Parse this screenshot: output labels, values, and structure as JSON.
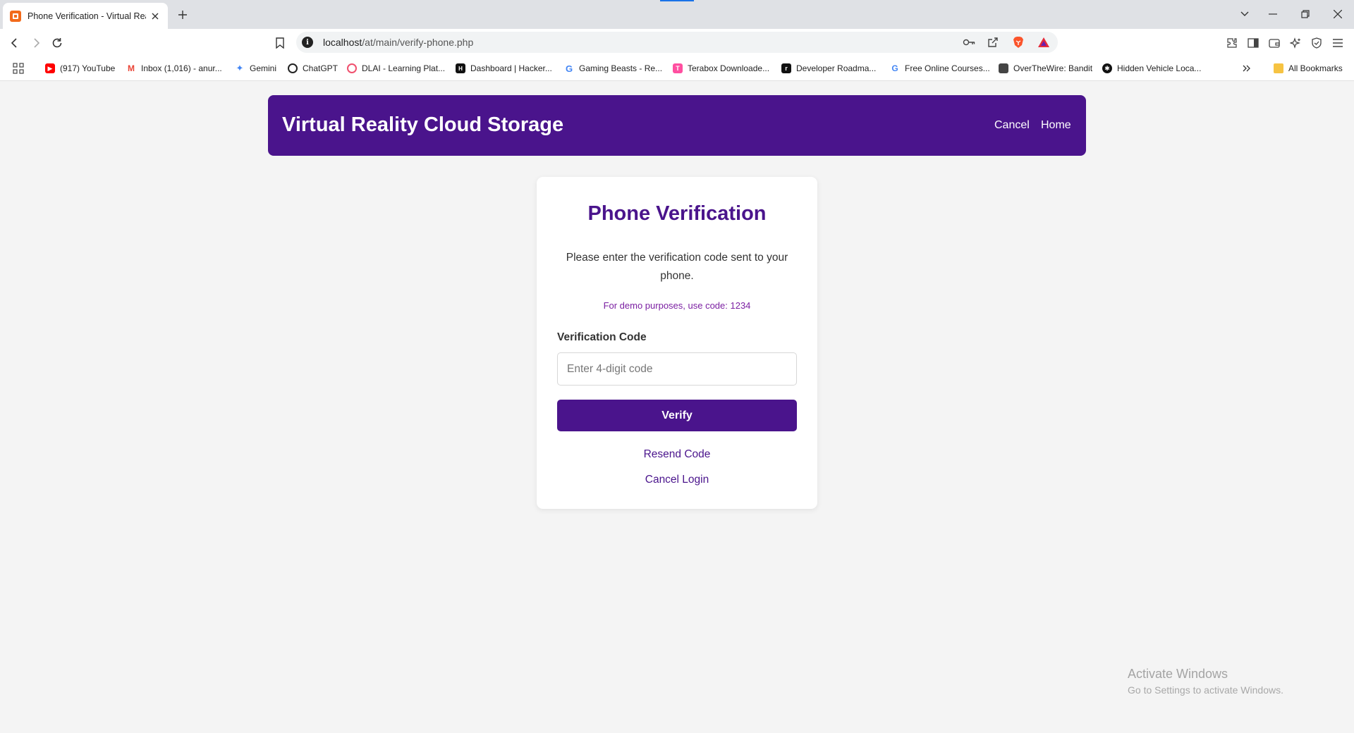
{
  "browser": {
    "tab": {
      "title": "Phone Verification - Virtual Rea"
    },
    "omnibox": {
      "url_host": "localhost",
      "url_path": "/at/main/verify-phone.php"
    },
    "bookmarks": [
      {
        "label": "(917) YouTube",
        "icon": "youtube-icon",
        "color": "#ff0000"
      },
      {
        "label": "Inbox (1,016) - anur...",
        "icon": "gmail-icon",
        "color": "#ea4335"
      },
      {
        "label": "Gemini",
        "icon": "gemini-icon",
        "color": "#4285f4"
      },
      {
        "label": "ChatGPT",
        "icon": "chatgpt-icon",
        "color": "#222222"
      },
      {
        "label": "DLAI - Learning Plat...",
        "icon": "dlai-icon",
        "color": "#f0506e"
      },
      {
        "label": "Dashboard | Hacker...",
        "icon": "hackerrank-icon",
        "color": "#111111"
      },
      {
        "label": "Gaming Beasts - Re...",
        "icon": "google-icon",
        "color": "#4285f4"
      },
      {
        "label": "Terabox Downloade...",
        "icon": "terabox-icon",
        "color": "#ff4fa0"
      },
      {
        "label": "Developer Roadma...",
        "icon": "roadmap-icon",
        "color": "#111111"
      },
      {
        "label": "Free Online Courses...",
        "icon": "google-g-icon",
        "color": "#4285f4"
      },
      {
        "label": "OverTheWire: Bandit",
        "icon": "overthewire-icon",
        "color": "#444444"
      },
      {
        "label": "Hidden Vehicle Loca...",
        "icon": "vehicle-icon",
        "color": "#111111"
      }
    ],
    "all_bookmarks": "All Bookmarks"
  },
  "header": {
    "title": "Virtual Reality Cloud Storage",
    "nav": {
      "cancel": "Cancel",
      "home": "Home"
    },
    "bg_color": "#4a148c"
  },
  "card": {
    "heading": "Phone Verification",
    "description": "Please enter the verification code sent to your phone.",
    "demo_note": "For demo purposes, use code: 1234",
    "field_label": "Verification Code",
    "input_placeholder": "Enter 4-digit code",
    "input_value": "",
    "verify_label": "Verify",
    "resend_label": "Resend Code",
    "cancel_label": "Cancel Login"
  },
  "watermark": {
    "line1": "Activate Windows",
    "line2": "Go to Settings to activate Windows."
  }
}
